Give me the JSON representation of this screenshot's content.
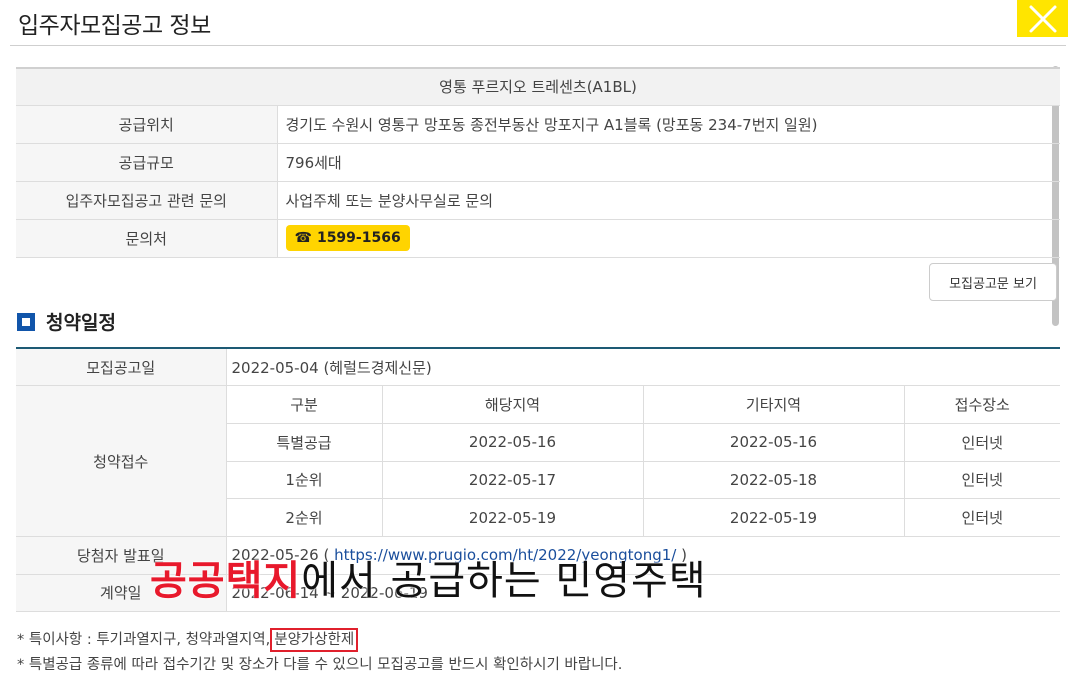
{
  "title": "입주자모집공고 정보",
  "info": {
    "complex_name": "영통 푸르지오 트레센츠(A1BL)",
    "rows": [
      {
        "label": "공급위치",
        "value": "경기도 수원시 영통구 망포동 종전부동산 망포지구 A1블록 (망포동 234-7번지 일원)"
      },
      {
        "label": "공급규모",
        "value": "796세대"
      },
      {
        "label": "입주자모집공고 관련 문의",
        "value": "사업주체 또는 분양사무실로 문의"
      }
    ],
    "contact_label": "문의처",
    "phone": "1599-1566",
    "phone_icon": "☎"
  },
  "notice_button": "모집공고문 보기",
  "schedule": {
    "title": "청약일정",
    "announcement_label": "모집공고일",
    "announcement_value": "2022-05-04 (헤럴드경제신문)",
    "application_label": "청약접수",
    "columns": [
      "구분",
      "해당지역",
      "기타지역",
      "접수장소"
    ],
    "rows": [
      [
        "특별공급",
        "2022-05-16",
        "2022-05-16",
        "인터넷"
      ],
      [
        "1순위",
        "2022-05-17",
        "2022-05-18",
        "인터넷"
      ],
      [
        "2순위",
        "2022-05-19",
        "2022-05-19",
        "인터넷"
      ]
    ],
    "winner_label": "당첨자 발표일",
    "winner_date": "2022-05-26 (",
    "winner_link": "https://www.prugio.com/ht/2022/yeongtong1/",
    "winner_close": ")",
    "contract_label": "계약일",
    "contract_value": "2022-06-14 ~ 2022-06-19"
  },
  "overlay": {
    "red": "공공택지",
    "black": "에서 공급하는 민영주택"
  },
  "notes": {
    "line1_prefix": "* 특이사항 : 투기과열지구, 청약과열지역,",
    "line1_highlight": "분양가상한제",
    "line2": "* 특별공급 종류에 따라 접수기간 및 장소가 다를 수 있으니 모집공고를 반드시 확인하시기 바랍니다."
  },
  "colors": {
    "accent_yellow": "#ffe500",
    "section_blue": "#1155aa",
    "table_top_border": "#1d5a74",
    "overlay_red": "#e8192c"
  }
}
